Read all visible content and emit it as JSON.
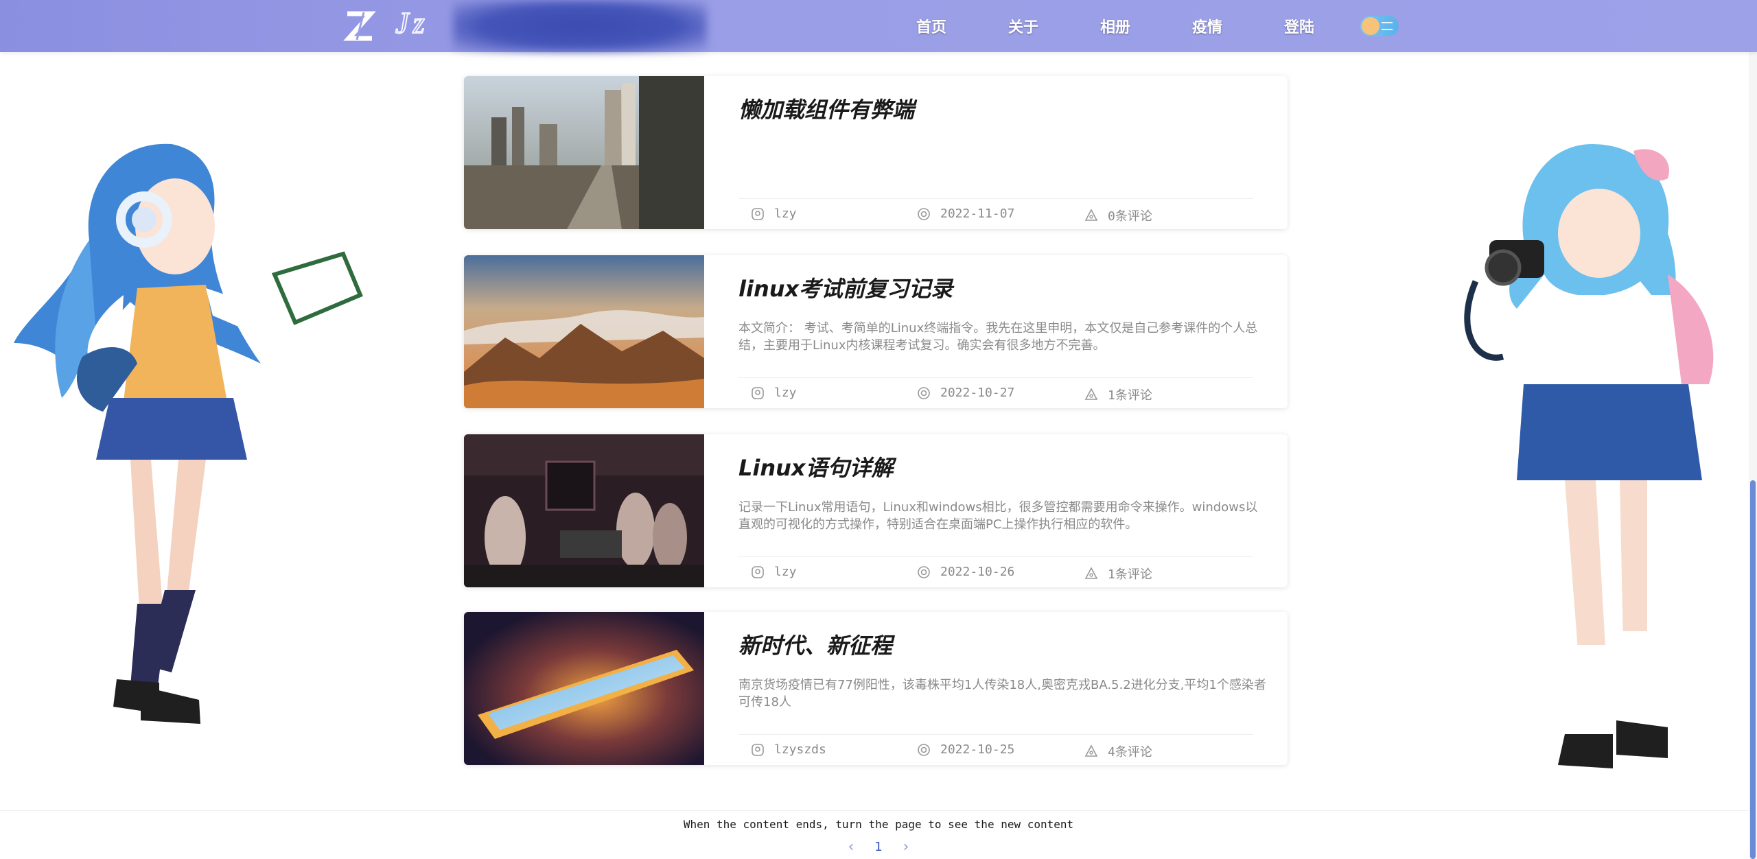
{
  "header": {
    "logo_text": "Jz",
    "nav": [
      "首页",
      "关于",
      "相册",
      "疫情",
      "登陆"
    ]
  },
  "posts": [
    {
      "title": "懒加载组件有弊端",
      "summary": "",
      "author": "lzy",
      "date": "2022-11-07",
      "comments": "0条评论",
      "image": "city-skyline-photo"
    },
    {
      "title": "linux考试前复习记录",
      "summary": "本文简介：  考试、考简单的Linux终端指令。我先在这里申明，本文仅是自己参考课件的个人总结，主要用于Linux内核课程考试复习。确实会有很多地方不完善。",
      "author": "lzy",
      "date": "2022-10-27",
      "comments": "1条评论",
      "image": "mountains-sunset-photo"
    },
    {
      "title": "Linux语句详解",
      "summary": "记录一下Linux常用语句，Linux和windows相比，很多管控都需要用命令来操作。windows以直观的可视化的方式操作，特别适合在桌面端PC上操作执行相应的软件。",
      "author": "lzy",
      "date": "2022-10-26",
      "comments": "1条评论",
      "image": "anime-group-illustration"
    },
    {
      "title": "新时代、新征程",
      "summary": "南京货场疫情已有77例阳性，该毒株平均1人传染18人,奥密克戎BA.5.2进化分支,平均1个感染者可传18人",
      "author": "lzyszds",
      "date": "2022-10-25",
      "comments": "4条评论",
      "image": "skylight-window-illustration"
    }
  ],
  "footer": {
    "note": "When the content ends, turn the page to see the new content",
    "prev": "‹",
    "page": "1",
    "next": "›"
  },
  "colors": {
    "header": "#9a9ee6",
    "accent": "#3a56c5"
  }
}
